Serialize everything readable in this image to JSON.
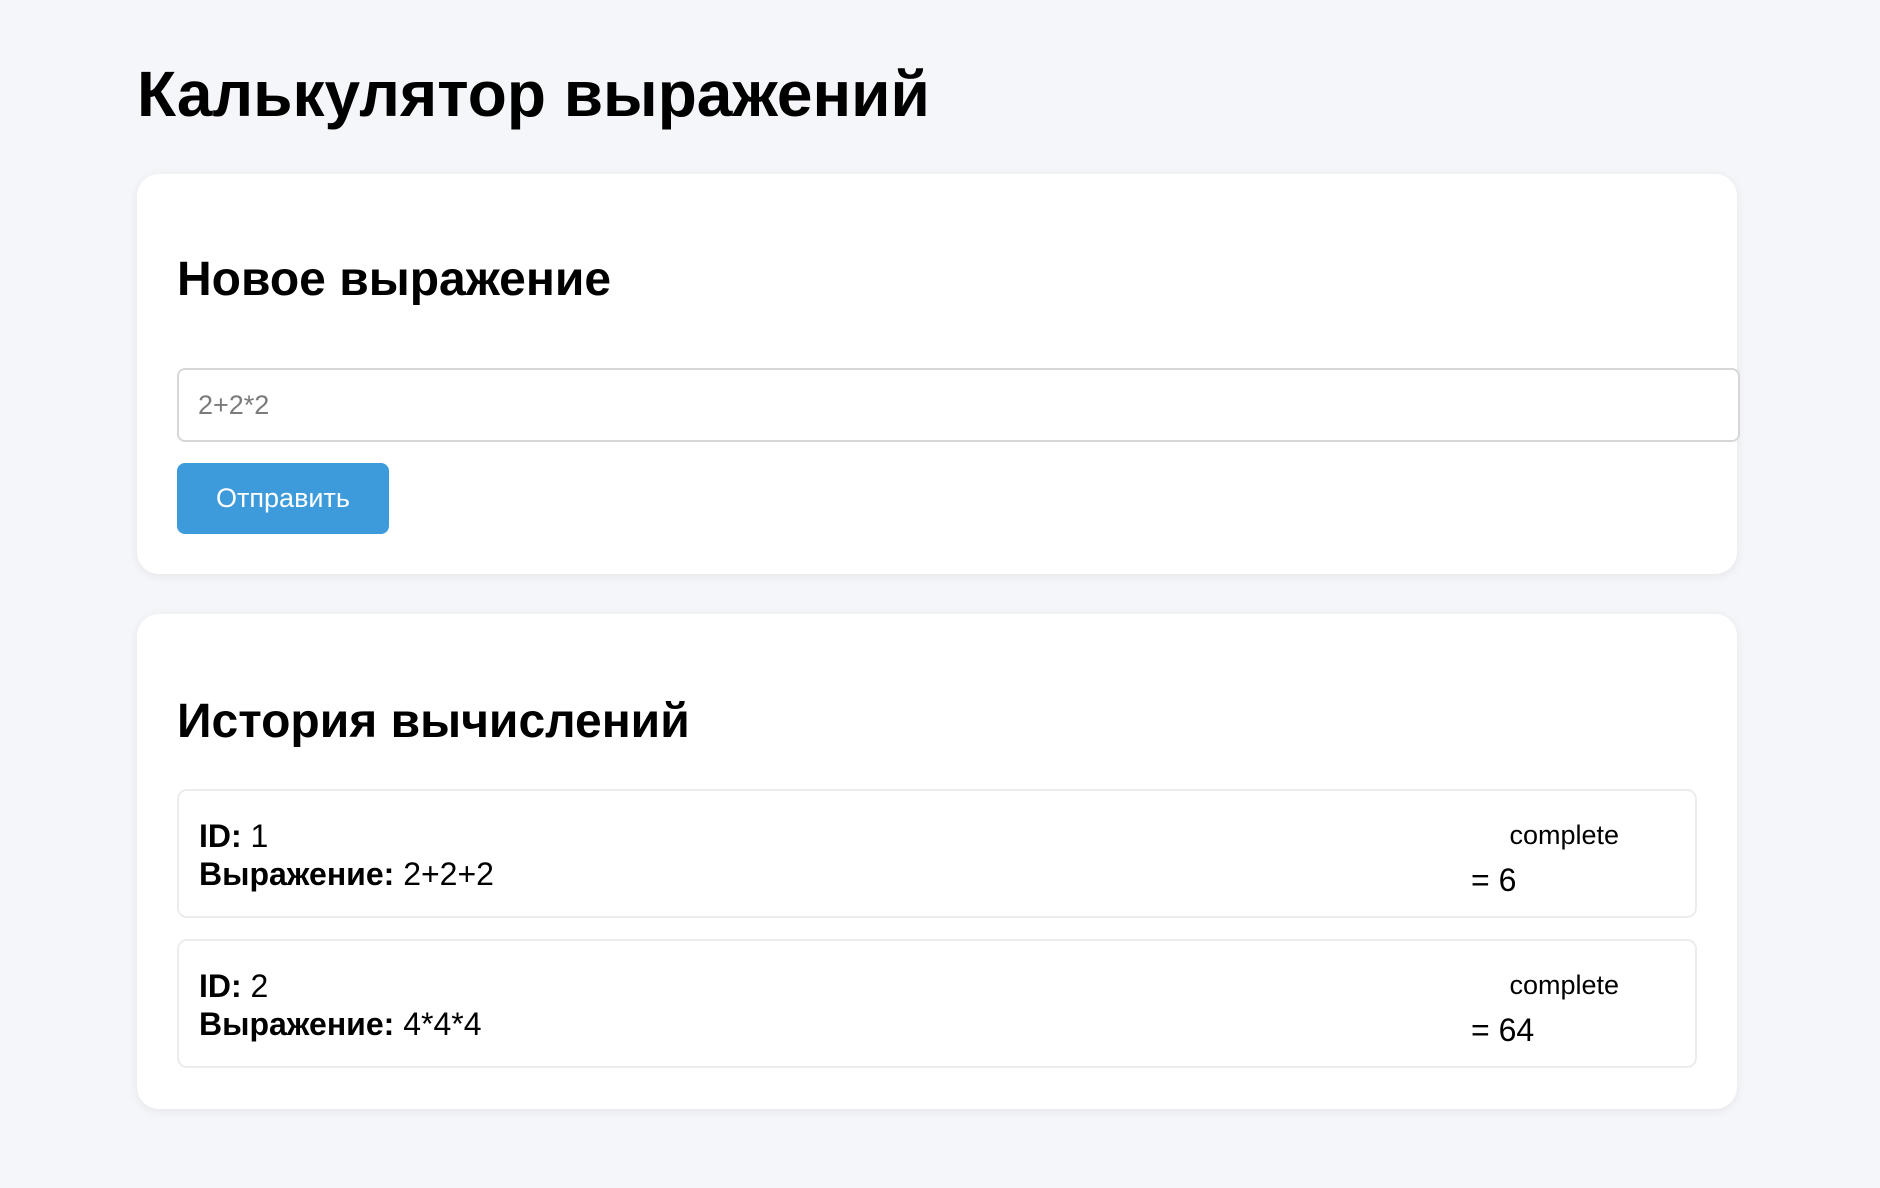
{
  "page": {
    "title": "Калькулятор выражений"
  },
  "new_expression": {
    "title": "Новое выражение",
    "input_value": "",
    "input_placeholder": "2+2*2",
    "submit_label": "Отправить"
  },
  "history": {
    "title": "История вычислений",
    "id_label": "ID:",
    "expression_label": "Выражение:",
    "items": [
      {
        "id": "1",
        "expression": "2+2+2",
        "status": "complete",
        "result": "= 6"
      },
      {
        "id": "2",
        "expression": "4*4*4",
        "status": "complete",
        "result": "= 64"
      }
    ]
  },
  "colors": {
    "page_background": "#f5f6f9",
    "card_background": "#ffffff",
    "button_background": "#3d9bdc",
    "button_text": "#ffffff",
    "input_border": "#d7d7d7"
  }
}
